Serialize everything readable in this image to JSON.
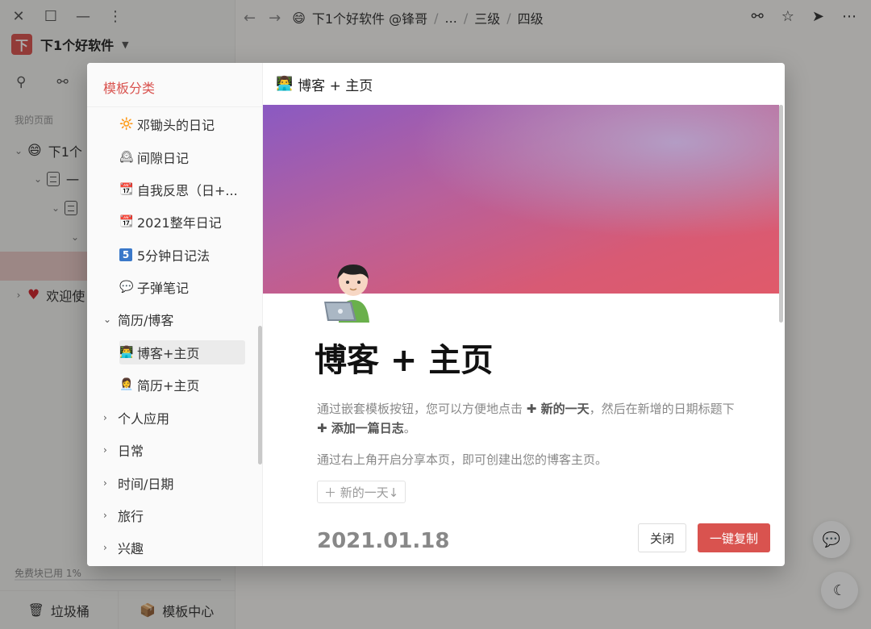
{
  "window": {
    "close": "✕",
    "maximize": "☐",
    "minimize": "—",
    "more": "⋮"
  },
  "workspace": {
    "logo": "下",
    "name": "下1个好软件"
  },
  "sidebar": {
    "section_title": "我的页面",
    "tree": [
      {
        "label": "下1个"
      },
      {
        "label": "一"
      },
      {
        "label": ""
      },
      {
        "label": "欢迎使"
      }
    ],
    "quota": "免费块已用 1%",
    "footer": {
      "trash": "垃圾桶",
      "templates": "模板中心"
    }
  },
  "breadcrumb": [
    "下1个好软件 @锋哥",
    "...",
    "三级",
    "四级"
  ],
  "modal": {
    "left_title": "模板分类",
    "items": [
      {
        "icon": "🔆",
        "label": "邓锄头的日记"
      },
      {
        "icon": "🕰",
        "label": "间隙日记"
      },
      {
        "icon": "📆",
        "label": "自我反思（日+..."
      },
      {
        "icon": "📆",
        "label": "2021整年日记"
      },
      {
        "icon": "5",
        "label": "5分钟日记法"
      },
      {
        "icon": "💬",
        "label": "子弹笔记"
      }
    ],
    "cat_resume": "简历/博客",
    "sub_items": [
      {
        "icon": "👨‍💻",
        "label": "博客+主页"
      },
      {
        "icon": "👩‍💼",
        "label": "简历+主页"
      }
    ],
    "categories": [
      "个人应用",
      "日常",
      "时间/日期",
      "旅行",
      "兴趣"
    ],
    "preview_header": "博客 + 主页",
    "title": "博客 + 主页",
    "desc1_a": "通过嵌套模板按钮，您可以方便地点击 ",
    "desc1_b": "✚ 新的一天",
    "desc1_c": "，然后在新增的日期标题下 ",
    "desc1_d": "✚ 添加一篇日志",
    "desc1_e": "。",
    "desc2": "通过右上角开启分享本页，即可创建出您的博客主页。",
    "new_day_button": "＋ 新的一天↓",
    "date": "2021.01.18",
    "close_button": "关闭",
    "copy_button": "一键复制"
  }
}
